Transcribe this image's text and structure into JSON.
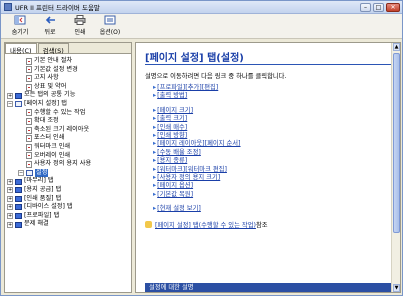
{
  "window": {
    "title": "UFR II 프린터 드라이버 도움말"
  },
  "toolbar": {
    "buttons": [
      {
        "label": "숨기기",
        "icon": "hide-icon"
      },
      {
        "label": "뒤로",
        "icon": "back-arrow-icon"
      },
      {
        "label": "인쇄",
        "icon": "print-icon"
      },
      {
        "label": "옵션(O)",
        "icon": "options-icon"
      }
    ]
  },
  "tabs": [
    {
      "label": "내용(C)"
    },
    {
      "label": "검색(S)"
    }
  ],
  "tree": [
    {
      "label": "기본 안내 절차",
      "type": "doc",
      "indent": 1
    },
    {
      "label": "기본값 설정 변경",
      "type": "doc",
      "indent": 1
    },
    {
      "label": "고지 사항",
      "type": "doc",
      "indent": 1
    },
    {
      "label": "상표 및 약어",
      "type": "doc",
      "indent": 1
    },
    {
      "label": "모든 탭의 공통 기능",
      "type": "folder-closed",
      "indent": 0
    },
    {
      "label": "[페이지 설정] 탭",
      "type": "folder-open",
      "indent": 0
    },
    {
      "label": "수행할 수 있는 작업",
      "type": "doc",
      "indent": 1
    },
    {
      "label": "확대 조정",
      "type": "doc",
      "indent": 1
    },
    {
      "label": "축소된 크기 레이아웃",
      "type": "doc",
      "indent": 1
    },
    {
      "label": "포스터 인쇄",
      "type": "doc",
      "indent": 1
    },
    {
      "label": "워터마크 인쇄",
      "type": "doc",
      "indent": 1
    },
    {
      "label": "오버레이 인쇄",
      "type": "doc",
      "indent": 1
    },
    {
      "label": "사용자 정의 용지 사용",
      "type": "doc",
      "indent": 1
    },
    {
      "label": "설정",
      "type": "folder-open",
      "indent": 1,
      "selected": true
    },
    {
      "label": "[마무리] 탭",
      "type": "folder-closed",
      "indent": 0
    },
    {
      "label": "[용지 공급] 탭",
      "type": "folder-closed",
      "indent": 0
    },
    {
      "label": "[인쇄 품질] 탭",
      "type": "folder-closed",
      "indent": 0
    },
    {
      "label": "[디바이스 설정] 탭",
      "type": "folder-closed",
      "indent": 0
    },
    {
      "label": "[프로파일] 탭",
      "type": "folder-closed",
      "indent": 0
    },
    {
      "label": "문제 해결",
      "type": "folder-closed",
      "indent": 0
    }
  ],
  "content": {
    "heading": "[페이지 설정] 탭(설정)",
    "intro": "설명으로 이동하려면 다음 링크 중 하나를 클릭합니다.",
    "group1": [
      "[프로파일][추가][편집]",
      "[출력 방법]"
    ],
    "group2": [
      "[페이지 크기]",
      "[출력 크기]",
      "[인쇄 매수]",
      "[인쇄 방향]",
      "[페이지 레이아웃][페이지 순서]",
      "[수동 배율 조정]",
      "[용지 종류]",
      "[워터마크][워터마크 편집]",
      "[사용자 정의 용지 크기]",
      "[페이지 옵션]",
      "[기본값 복원]"
    ],
    "group3": [
      "[현재 설정 보기]"
    ],
    "note_link": "[페이지 설정] 탭(수행할 수 있는 작업)",
    "note_suffix": " 참조",
    "bottom_bar": "설정에 대한 설명"
  },
  "colors": {
    "link": "#1a3fa8",
    "heading": "#1a3fa8",
    "selection": "#316ac5"
  }
}
